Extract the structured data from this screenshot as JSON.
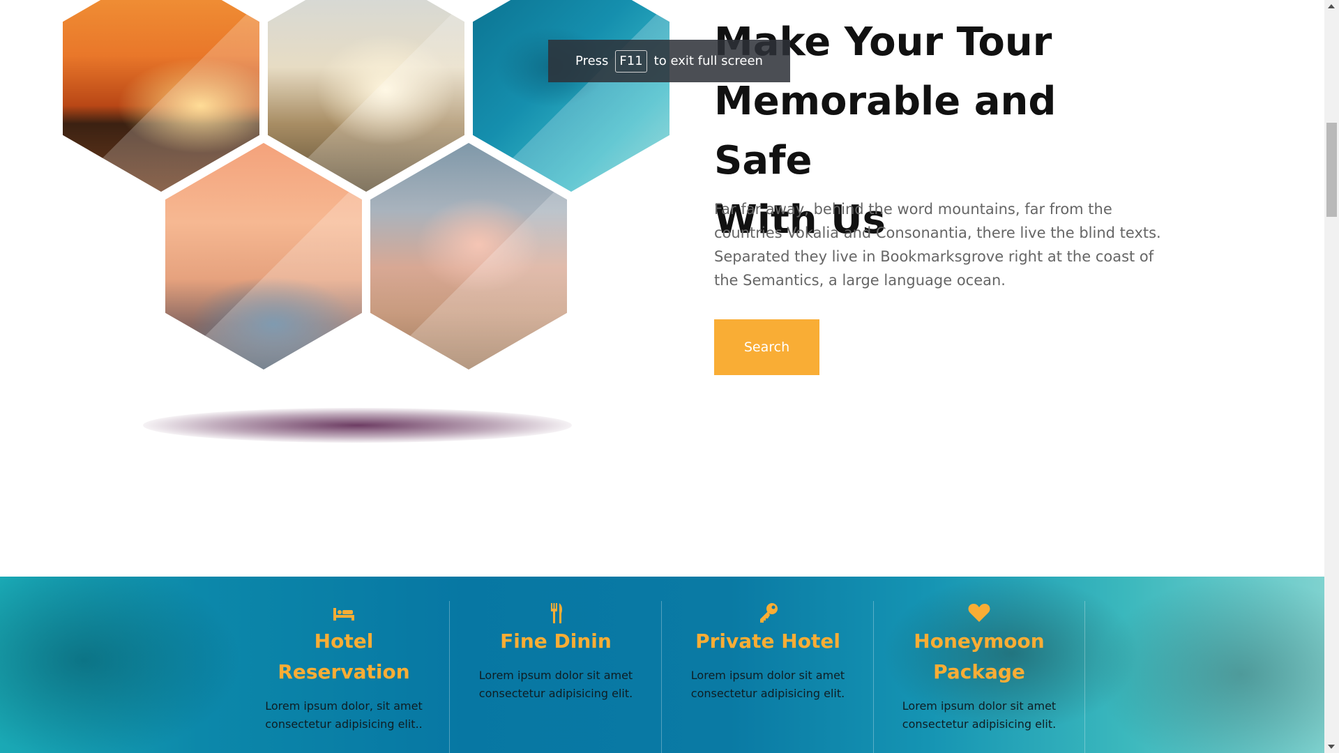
{
  "fullscreen_notice": {
    "press": "Press",
    "key": "F11",
    "rest": "to exit full screen"
  },
  "hero": {
    "title_lines": [
      "Make Your Tour",
      "Memorable and Safe",
      "With Us"
    ],
    "description": "Far far away, behind the word mountains, far from the countries Vokalia and Consonantia, there live the blind texts. Separated they live in Bookmarksgrove right at the coast of the Semantics, a large language ocean.",
    "button_label": "Search"
  },
  "services": [
    {
      "icon": "bed-icon",
      "title": "Hotel Reservation",
      "description": "Lorem ipsum dolor, sit amet consectetur adipisicing elit.."
    },
    {
      "icon": "utensils-icon",
      "title": "Fine Dinin",
      "description": "Lorem ipsum dolor sit amet consectetur adipisicing elit."
    },
    {
      "icon": "key-icon",
      "title": "Private Hotel",
      "description": "Lorem ipsum dolor sit amet consectetur adipisicing elit."
    },
    {
      "icon": "heart-icon",
      "title": "Honeymoon Package",
      "description": "Lorem ipsum dolor sit amet consectetur adipisicing elit."
    }
  ],
  "colors": {
    "accent": "#f9ad35",
    "title_text": "#111111",
    "body_text": "#666666"
  }
}
